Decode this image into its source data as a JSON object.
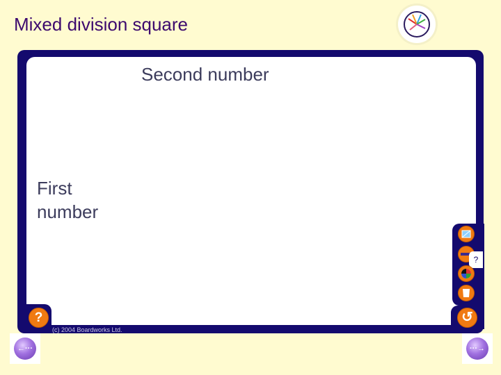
{
  "slide": {
    "title": "Mixed division square",
    "logo_icon": "boardworks-logo-icon"
  },
  "panel": {
    "second_number_label": "Second number",
    "first_number_label": "First number"
  },
  "toolbar": {
    "help_label": "?",
    "fold_label": "?",
    "tools": [
      {
        "icon": "notepad-icon"
      },
      {
        "icon": "pen-icon"
      },
      {
        "icon": "color-wheel-icon"
      },
      {
        "icon": "eraser-bin-icon"
      }
    ],
    "undo_icon": "undo-icon"
  },
  "footer": {
    "copyright": "(c) 2004 Boardworks Ltd."
  },
  "nav": {
    "prev_icon": "previous-arrow-icon",
    "next_icon": "next-arrow-icon"
  },
  "colors": {
    "background": "#fffbd0",
    "frame": "#140a6e",
    "title": "#3d0a6e",
    "accent": "#f07a12"
  }
}
